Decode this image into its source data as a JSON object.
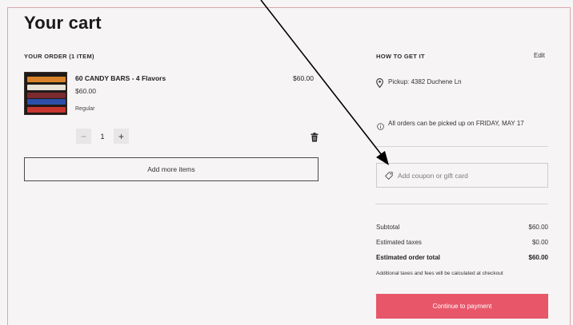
{
  "page": {
    "title": "Your cart"
  },
  "order": {
    "label": "YOUR ORDER (1 ITEM)",
    "item": {
      "name": "60 CANDY BARS - 4 Flavors",
      "price": "$60.00",
      "variant": "Regular",
      "line_total": "$60.00",
      "quantity": "1",
      "decrement_label": "−",
      "increment_label": "+"
    },
    "add_more_label": "Add more items"
  },
  "fulfillment": {
    "label": "HOW TO GET IT",
    "edit_label": "Edit",
    "pickup_text": "Pickup: 4382 Duchene Ln",
    "info_text": "All orders can be picked up on FRIDAY, MAY 17"
  },
  "coupon": {
    "placeholder": "Add coupon or gift card"
  },
  "summary": {
    "subtotal_label": "Subtotal",
    "subtotal_value": "$60.00",
    "taxes_label": "Estimated taxes",
    "taxes_value": "$0.00",
    "total_label": "Estimated order total",
    "total_value": "$60.00",
    "note": "Additional taxes and fees will be calculated at checkout"
  },
  "checkout": {
    "label": "Continue to payment"
  },
  "icons": {
    "pickup": "location-pin-icon",
    "info": "info-icon",
    "coupon": "tag-icon",
    "delete": "trash-icon"
  },
  "colors": {
    "accent": "#e8566a",
    "frame_border": "#d8a7ad",
    "background": "#f7f4f5"
  }
}
